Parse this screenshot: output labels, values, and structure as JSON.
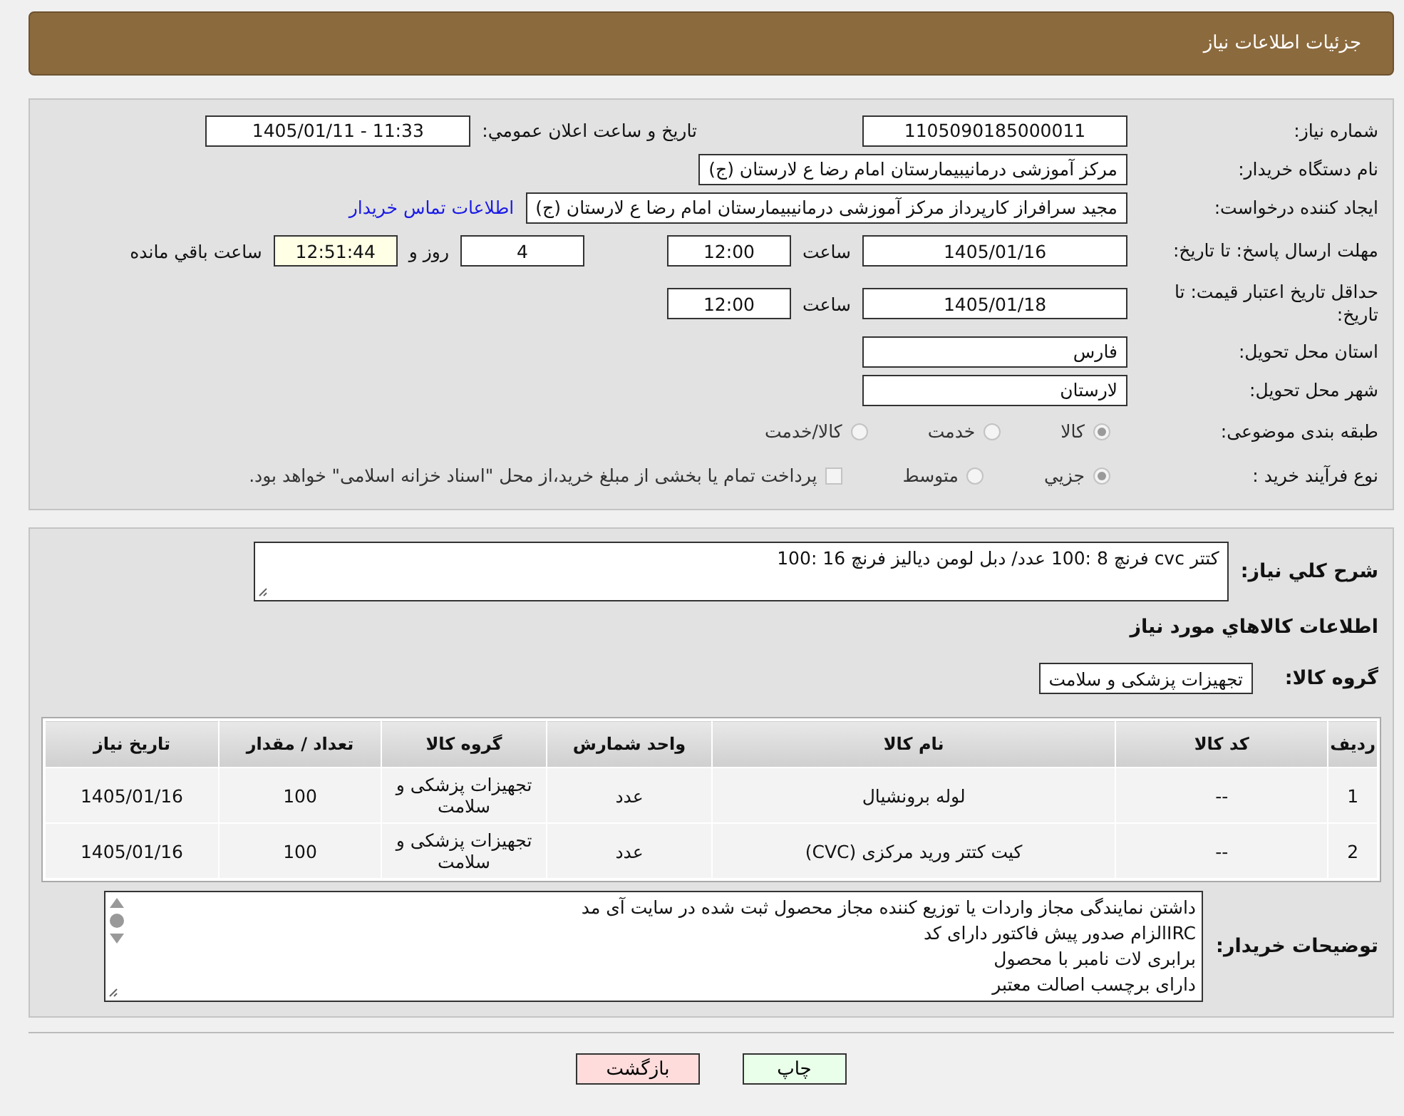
{
  "header": {
    "title": "جزئیات اطلاعات نیاز"
  },
  "details": {
    "need_number": {
      "label": "شماره نیاز:",
      "value": "1105090185000011"
    },
    "announce_datetime": {
      "label": "تاریخ و ساعت اعلان عمومي:",
      "value": "1405/01/11 - 11:33"
    },
    "buyer_org": {
      "label": "نام دستگاه خریدار:",
      "value": "مرکز آموزشی درمانیبیمارستان امام رضا  ع  لارستان (ج)"
    },
    "requester": {
      "label": "ایجاد کننده درخواست:",
      "value": "مجید سرافراز کارپرداز  مرکز آموزشی درمانیبیمارستان امام رضا  ع  لارستان (ج)",
      "link": "اطلاعات تماس خریدار"
    },
    "reply_deadline": {
      "label": "مهلت ارسال پاسخ: تا تاریخ:",
      "date": "1405/01/16",
      "time_label": "ساعت",
      "time": "12:00",
      "days": "4",
      "days_label": "روز و",
      "remaining": "12:51:44",
      "remaining_label": "ساعت باقي مانده"
    },
    "price_validity": {
      "label": "حداقل تاریخ اعتبار قیمت: تا تاریخ:",
      "date": "1405/01/18",
      "time_label": "ساعت",
      "time": "12:00"
    },
    "province": {
      "label": "استان محل تحویل:",
      "value": "فارس"
    },
    "city": {
      "label": "شهر محل تحویل:",
      "value": "لارستان"
    },
    "category": {
      "label": "طبقه بندی موضوعی:",
      "options": [
        {
          "label": "کالا",
          "selected": true
        },
        {
          "label": "خدمت",
          "selected": false
        },
        {
          "label": "کالا/خدمت",
          "selected": false
        }
      ]
    },
    "purchase_type": {
      "label": "نوع فرآیند خرید :",
      "options": [
        {
          "label": "جزيي",
          "selected": true
        },
        {
          "label": "متوسط",
          "selected": false
        }
      ],
      "checkbox": {
        "label": "پرداخت تمام یا بخشی از مبلغ خرید،از محل \"اسناد خزانه اسلامی\" خواهد بود.",
        "checked": false
      }
    }
  },
  "summary": {
    "label": "شرح كلي نياز:",
    "value": "کتتر cvc فرنچ 8 :100 عدد/ دبل لومن دیالیز فرنچ 16 :100"
  },
  "goods": {
    "title": "اطلاعات كالاهاي مورد نياز",
    "group_label": "گروه کالا:",
    "group_value": "تجهیزات پزشکی و سلامت",
    "table": {
      "columns": [
        "ردیف",
        "کد کالا",
        "نام کالا",
        "واحد شمارش",
        "گروه کالا",
        "تعداد / مقدار",
        "تاریخ نیاز"
      ],
      "rows": [
        [
          "1",
          "--",
          "لوله برونشیال",
          "عدد",
          "تجهیزات پزشکی و سلامت",
          "100",
          "1405/01/16"
        ],
        [
          "2",
          "--",
          "کیت کتتر ورید مرکزی (CVC)",
          "عدد",
          "تجهیزات پزشکی و سلامت",
          "100",
          "1405/01/16"
        ]
      ]
    }
  },
  "buyer_notes": {
    "label": "توضیحات خریدار:",
    "lines": [
      "داشتن نمایندگی مجاز واردات یا توزیع کننده مجاز محصول ثبت شده در سایت آی مد",
      "IRCالزام صدور پیش فاکتور دارای کد",
      "برابری لات نامبر با محصول",
      "دارای برچسب اصالت معتبر"
    ]
  },
  "buttons": [
    {
      "label": "چاپ",
      "kind": "print"
    },
    {
      "label": "بازگشت",
      "kind": "back"
    }
  ]
}
